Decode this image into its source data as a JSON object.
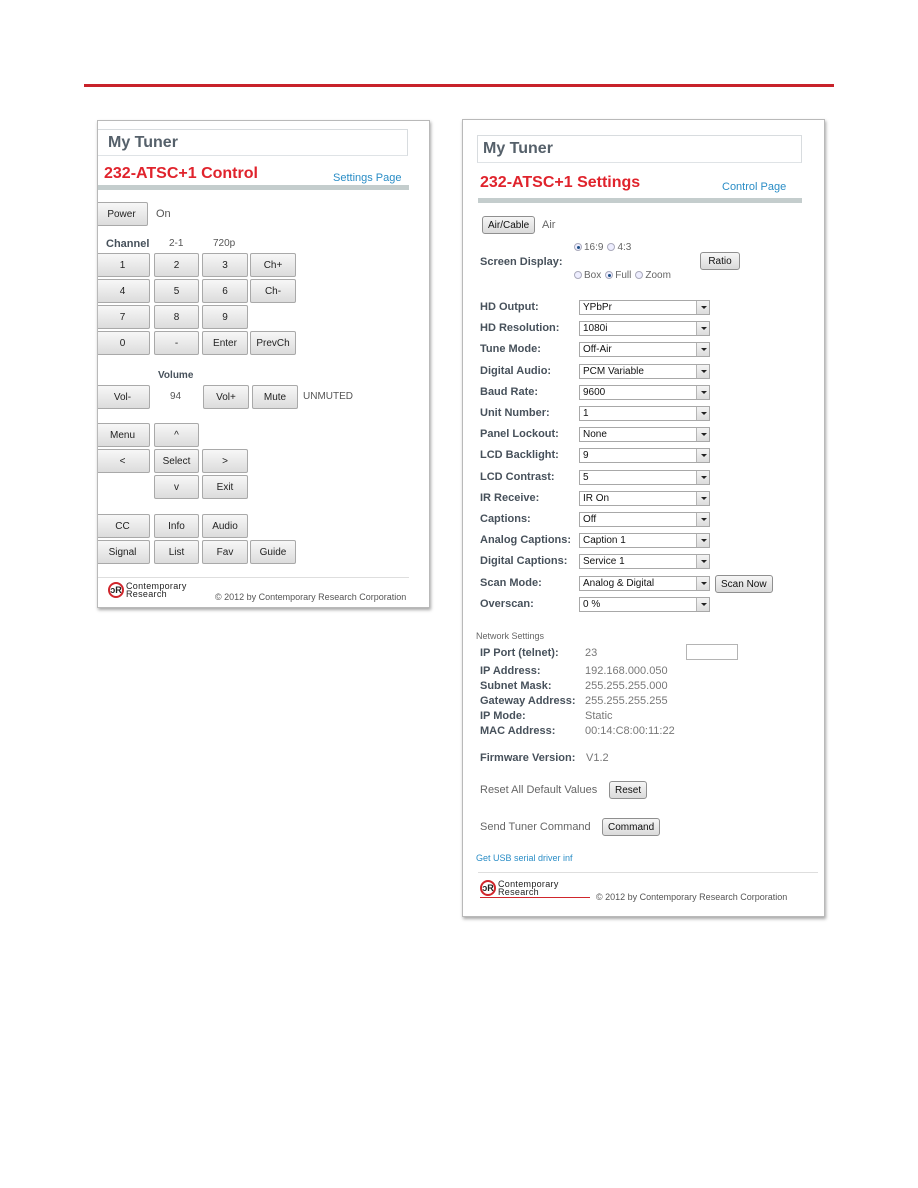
{
  "control_page": {
    "brand": "My Tuner",
    "title": "232-ATSC+1 Control",
    "link": "Settings Page",
    "power": {
      "button": "Power",
      "status": "On"
    },
    "channel": {
      "label": "Channel",
      "value": "2-1",
      "resolution": "720p"
    },
    "keypad": [
      [
        "1",
        "2",
        "3",
        "Ch+"
      ],
      [
        "4",
        "5",
        "6",
        "Ch-"
      ],
      [
        "7",
        "8",
        "9"
      ],
      [
        "0",
        "-",
        "Enter",
        "PrevCh"
      ]
    ],
    "volume": {
      "label": "Volume",
      "down": "Vol-",
      "value": "94",
      "up": "Vol+",
      "mute": "Mute",
      "mute_status": "UNMUTED"
    },
    "nav": {
      "menu": "Menu",
      "up": "^",
      "left": "<",
      "select": "Select",
      "right": ">",
      "down": "v",
      "exit": "Exit"
    },
    "function_rows": [
      [
        "CC",
        "Info",
        "Audio"
      ],
      [
        "Signal",
        "List",
        "Fav",
        "Guide"
      ]
    ],
    "footer": {
      "logo_line1": "Contemporary",
      "logo_line2": "Research",
      "copyright": "© 2012 by Contemporary Research Corporation"
    }
  },
  "settings_page": {
    "brand": "My Tuner",
    "title": "232-ATSC+1 Settings",
    "link": "Control Page",
    "air_cable": {
      "button": "Air/Cable",
      "value": "Air"
    },
    "screen_display": {
      "label": "Screen Display:",
      "aspect_options": [
        {
          "label": "16:9",
          "selected": true
        },
        {
          "label": "4:3",
          "selected": false
        }
      ],
      "mode_options": [
        {
          "label": "Box",
          "selected": false
        },
        {
          "label": "Full",
          "selected": true
        },
        {
          "label": "Zoom",
          "selected": false
        }
      ],
      "button": "Ratio"
    },
    "fields": [
      {
        "label": "HD Output:",
        "value": "YPbPr"
      },
      {
        "label": "HD Resolution:",
        "value": "1080i"
      },
      {
        "label": "Tune Mode:",
        "value": "Off-Air"
      },
      {
        "label": "Digital Audio:",
        "value": "PCM Variable"
      },
      {
        "label": "Baud Rate:",
        "value": "9600"
      },
      {
        "label": "Unit Number:",
        "value": "1"
      },
      {
        "label": "Panel Lockout:",
        "value": "None"
      },
      {
        "label": "LCD Backlight:",
        "value": "9"
      },
      {
        "label": "LCD Contrast:",
        "value": "5"
      },
      {
        "label": "IR Receive:",
        "value": "IR On"
      },
      {
        "label": "Captions:",
        "value": "Off"
      },
      {
        "label": "Analog Captions:",
        "value": "Caption 1"
      },
      {
        "label": "Digital Captions:",
        "value": "Service 1"
      },
      {
        "label": "Scan Mode:",
        "value": "Analog & Digital"
      },
      {
        "label": "Overscan:",
        "value": "0 %"
      }
    ],
    "scan_now": "Scan Now",
    "network": {
      "title": "Network Settings",
      "rows": [
        {
          "label": "IP Port (telnet):",
          "value": "23"
        },
        {
          "label": "IP Address:",
          "value": "192.168.000.050"
        },
        {
          "label": "Subnet Mask:",
          "value": "255.255.255.000"
        },
        {
          "label": "Gateway Address:",
          "value": "255.255.255.255"
        },
        {
          "label": "IP Mode:",
          "value": "Static"
        },
        {
          "label": "MAC Address:",
          "value": "00:14:C8:00:11:22"
        }
      ],
      "port_input": ""
    },
    "firmware": {
      "label": "Firmware Version:",
      "value": "V1.2"
    },
    "reset": {
      "label": "Reset All Default Values",
      "button": "Reset"
    },
    "command": {
      "label": "Send Tuner Command",
      "button": "Command"
    },
    "usb_link": "Get USB serial driver inf",
    "footer": {
      "logo_line1": "Contemporary",
      "logo_line2": "Research",
      "copyright": "© 2012 by Contemporary Research Corporation"
    }
  }
}
